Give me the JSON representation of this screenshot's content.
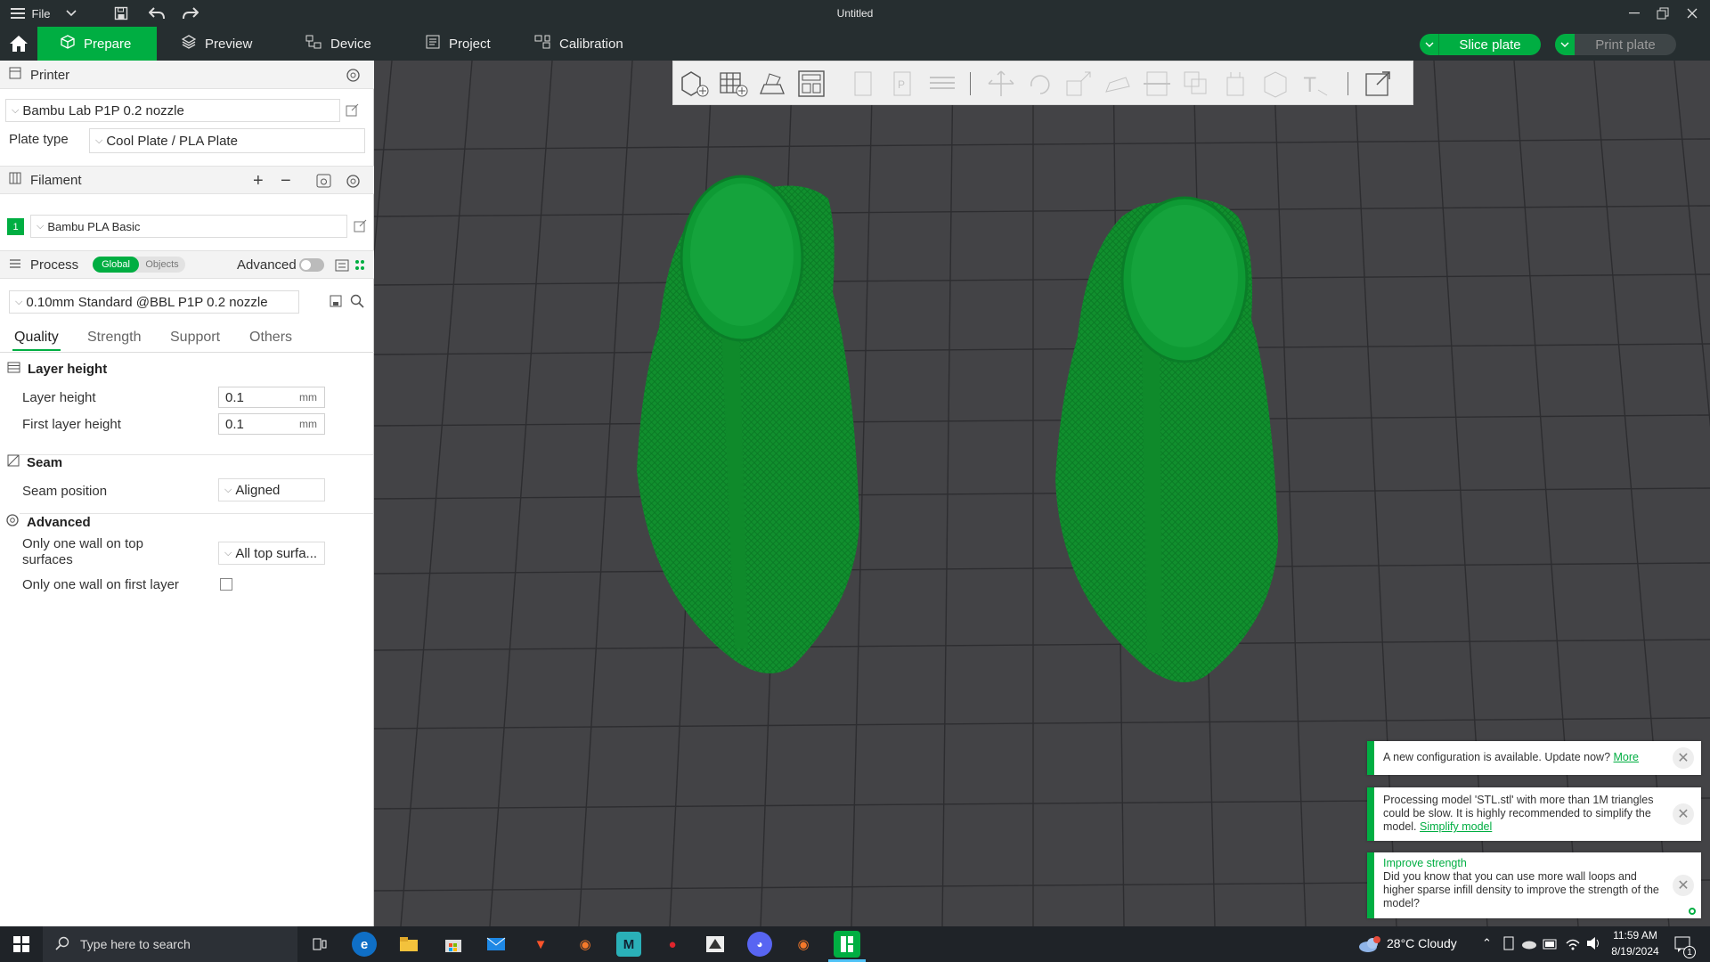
{
  "titlebar": {
    "menu_label": "File",
    "title": "Untitled"
  },
  "topbar": {
    "tabs": [
      {
        "label": "Prepare",
        "icon": "cube-icon"
      },
      {
        "label": "Preview",
        "icon": "layers-icon"
      },
      {
        "label": "Device",
        "icon": "device-icon"
      },
      {
        "label": "Project",
        "icon": "project-icon"
      },
      {
        "label": "Calibration",
        "icon": "calibration-icon"
      }
    ],
    "slice_label": "Slice plate",
    "print_label": "Print plate"
  },
  "printer": {
    "section_label": "Printer",
    "selected": "Bambu Lab P1P 0.2 nozzle",
    "plate_type_label": "Plate type",
    "plate_type_value": "Cool Plate / PLA Plate"
  },
  "filament": {
    "section_label": "Filament",
    "items": [
      {
        "index": "1",
        "name": "Bambu PLA Basic",
        "color": "#00ae42"
      }
    ]
  },
  "process": {
    "section_label": "Process",
    "toggle_global": "Global",
    "toggle_objects": "Objects",
    "advanced_label": "Advanced",
    "preset": "0.10mm Standard @BBL P1P 0.2 nozzle",
    "tabs": [
      "Quality",
      "Strength",
      "Support",
      "Others"
    ],
    "groups": {
      "layer_height": {
        "title": "Layer height",
        "layer_height_label": "Layer height",
        "layer_height_value": "0.1",
        "first_layer_height_label": "First layer height",
        "first_layer_height_value": "0.1",
        "unit": "mm"
      },
      "seam": {
        "title": "Seam",
        "seam_position_label": "Seam position",
        "seam_position_value": "Aligned"
      },
      "advanced": {
        "title": "Advanced",
        "top_wall_label_line1": "Only one wall on top",
        "top_wall_label_line2": "surfaces",
        "top_wall_value": "All top surfa...",
        "first_layer_wall_label": "Only one wall on first layer",
        "first_layer_wall_checked": false
      }
    }
  },
  "notifications": [
    {
      "text": "A new configuration is available. Update now?",
      "link": "More"
    },
    {
      "text": "Processing model 'STL.stl' with more than 1M triangles could be slow. It is highly recommended to simplify the model.",
      "link": "Simplify model"
    },
    {
      "title": "Improve strength",
      "text": "Did you know that you can use more wall loops and higher sparse infill density to improve the strength of the model?"
    }
  ],
  "taskbar": {
    "search_placeholder": "Type here to search",
    "weather": "28°C  Cloudy",
    "time": "11:59 AM",
    "date": "8/19/2024",
    "notification_badge": "1"
  },
  "colors": {
    "accent": "#00ae42",
    "model": "#119c33",
    "dark_bar": "#262e30",
    "viewport": "#434346"
  }
}
